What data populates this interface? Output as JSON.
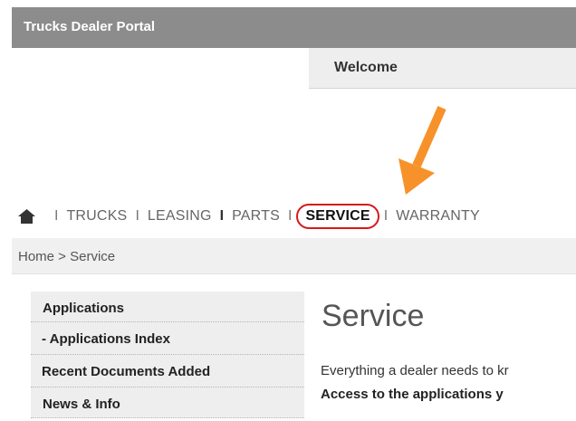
{
  "header": {
    "title": "Trucks Dealer Portal",
    "welcome": "Welcome"
  },
  "nav": {
    "home_icon": "home-icon",
    "separators": [
      "I",
      "I",
      "I",
      "I",
      "I"
    ],
    "items": [
      {
        "label": "TRUCKS"
      },
      {
        "label": "LEASING"
      },
      {
        "label": "PARTS"
      },
      {
        "label": "SERVICE",
        "active": true
      },
      {
        "label": "WARRANTY"
      }
    ]
  },
  "breadcrumb": "Home > Service",
  "sidebar": {
    "items": [
      {
        "label": "Applications"
      },
      {
        "label": "- Applications Index"
      },
      {
        "label": "Recent Documents Added"
      },
      {
        "label": "News & Info"
      }
    ]
  },
  "main": {
    "title": "Service",
    "intro_line1": "Everything a dealer needs to kr",
    "intro_line2": "Access to the applications y"
  },
  "colors": {
    "arrow": "#f7922a",
    "highlight": "#d6191c",
    "header_bg": "#8c8c8c"
  }
}
